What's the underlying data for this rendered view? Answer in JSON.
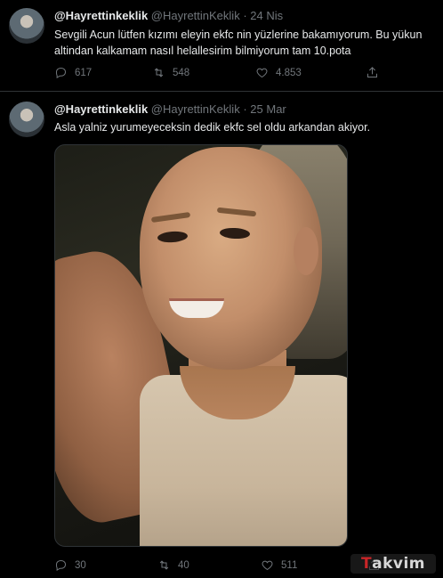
{
  "tweets": [
    {
      "author_name": "@Hayrettinkeklik",
      "handle": "@HayrettinKeklik",
      "separator": "·",
      "date": "24 Nis",
      "text_line1": "Sevgili Acun lütfen kızımı eleyin ekfc nin yüzlerine bakamıyorum. Bu yükun",
      "text_line2": "altindan kalkamam nasıl helallesirim bilmiyorum tam 10.pota",
      "replies": "617",
      "retweets": "548",
      "likes": "4.853"
    },
    {
      "author_name": "@Hayrettinkeklik",
      "handle": "@HayrettinKeklik",
      "separator": "·",
      "date": "25 Mar",
      "text_line1": "Asla yalniz yurumeyeceksin dedik ekfc sel oldu arkandan akiyor.",
      "replies": "30",
      "retweets": "40",
      "likes": "511"
    }
  ],
  "icons": {
    "reply": "reply-icon",
    "retweet": "retweet-icon",
    "like": "heart-icon",
    "share": "share-icon"
  },
  "watermark": {
    "brand_a": "T",
    "brand_b": "akvim"
  },
  "colors": {
    "background": "#000000",
    "text": "#e7e9ea",
    "muted": "#71767b",
    "watermark_accent": "#c82528"
  }
}
